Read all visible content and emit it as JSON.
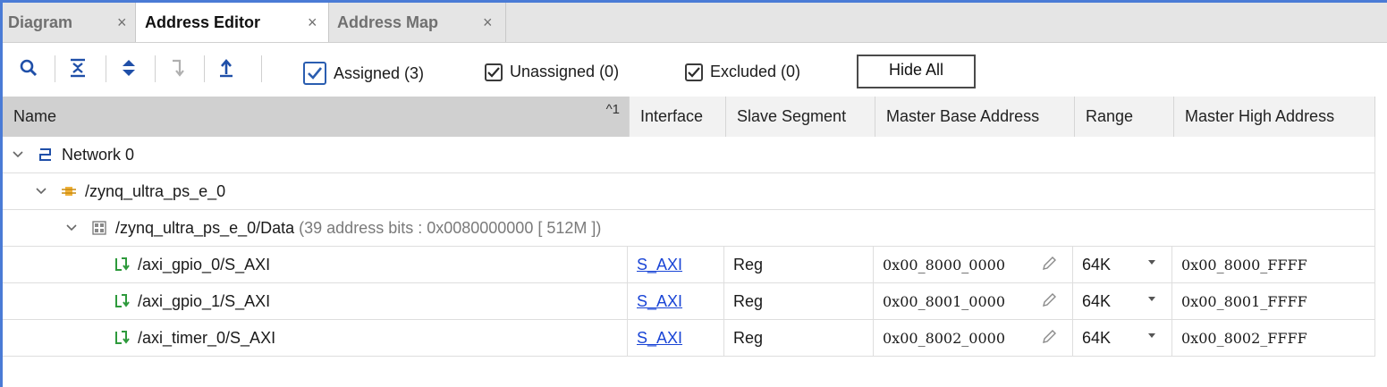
{
  "tabs": [
    {
      "label": "Diagram",
      "close": "×"
    },
    {
      "label": "Address Editor",
      "close": "×"
    },
    {
      "label": "Address Map",
      "close": "×"
    }
  ],
  "toolbar": {
    "icons": [
      "search-icon",
      "collapse-all-icon",
      "expand-all-icon",
      "auto-assign-icon",
      "move-up-icon"
    ],
    "filters": [
      {
        "label": "Assigned (3)",
        "checked": true
      },
      {
        "label": "Unassigned (0)",
        "checked": true
      },
      {
        "label": "Excluded (0)",
        "checked": true
      }
    ],
    "hide_all": "Hide All"
  },
  "table": {
    "columns": [
      "Name",
      "Interface",
      "Slave Segment",
      "Master Base Address",
      "Range",
      "Master High Address"
    ],
    "sort_indicator": "^1",
    "network": "Network 0",
    "master": "/zynq_ultra_ps_e_0",
    "space": {
      "name": "/zynq_ultra_ps_e_0/Data",
      "detail": "(39 address bits : 0x0080000000 [ 512M ])"
    },
    "rows": [
      {
        "name": "/axi_gpio_0/S_AXI",
        "interface": "S_AXI",
        "segment": "Reg",
        "base": "0x00_8000_0000",
        "range": "64K",
        "high": "0x00_8000_FFFF"
      },
      {
        "name": "/axi_gpio_1/S_AXI",
        "interface": "S_AXI",
        "segment": "Reg",
        "base": "0x00_8001_0000",
        "range": "64K",
        "high": "0x00_8001_FFFF"
      },
      {
        "name": "/axi_timer_0/S_AXI",
        "interface": "S_AXI",
        "segment": "Reg",
        "base": "0x00_8002_0000",
        "range": "64K",
        "high": "0x00_8002_FFFF"
      }
    ]
  },
  "colors": {
    "accent": "#4a7bd6",
    "link": "#1a45d6",
    "header_bg": "#f2f2f2",
    "tab_bg": "#e5e5e5"
  }
}
